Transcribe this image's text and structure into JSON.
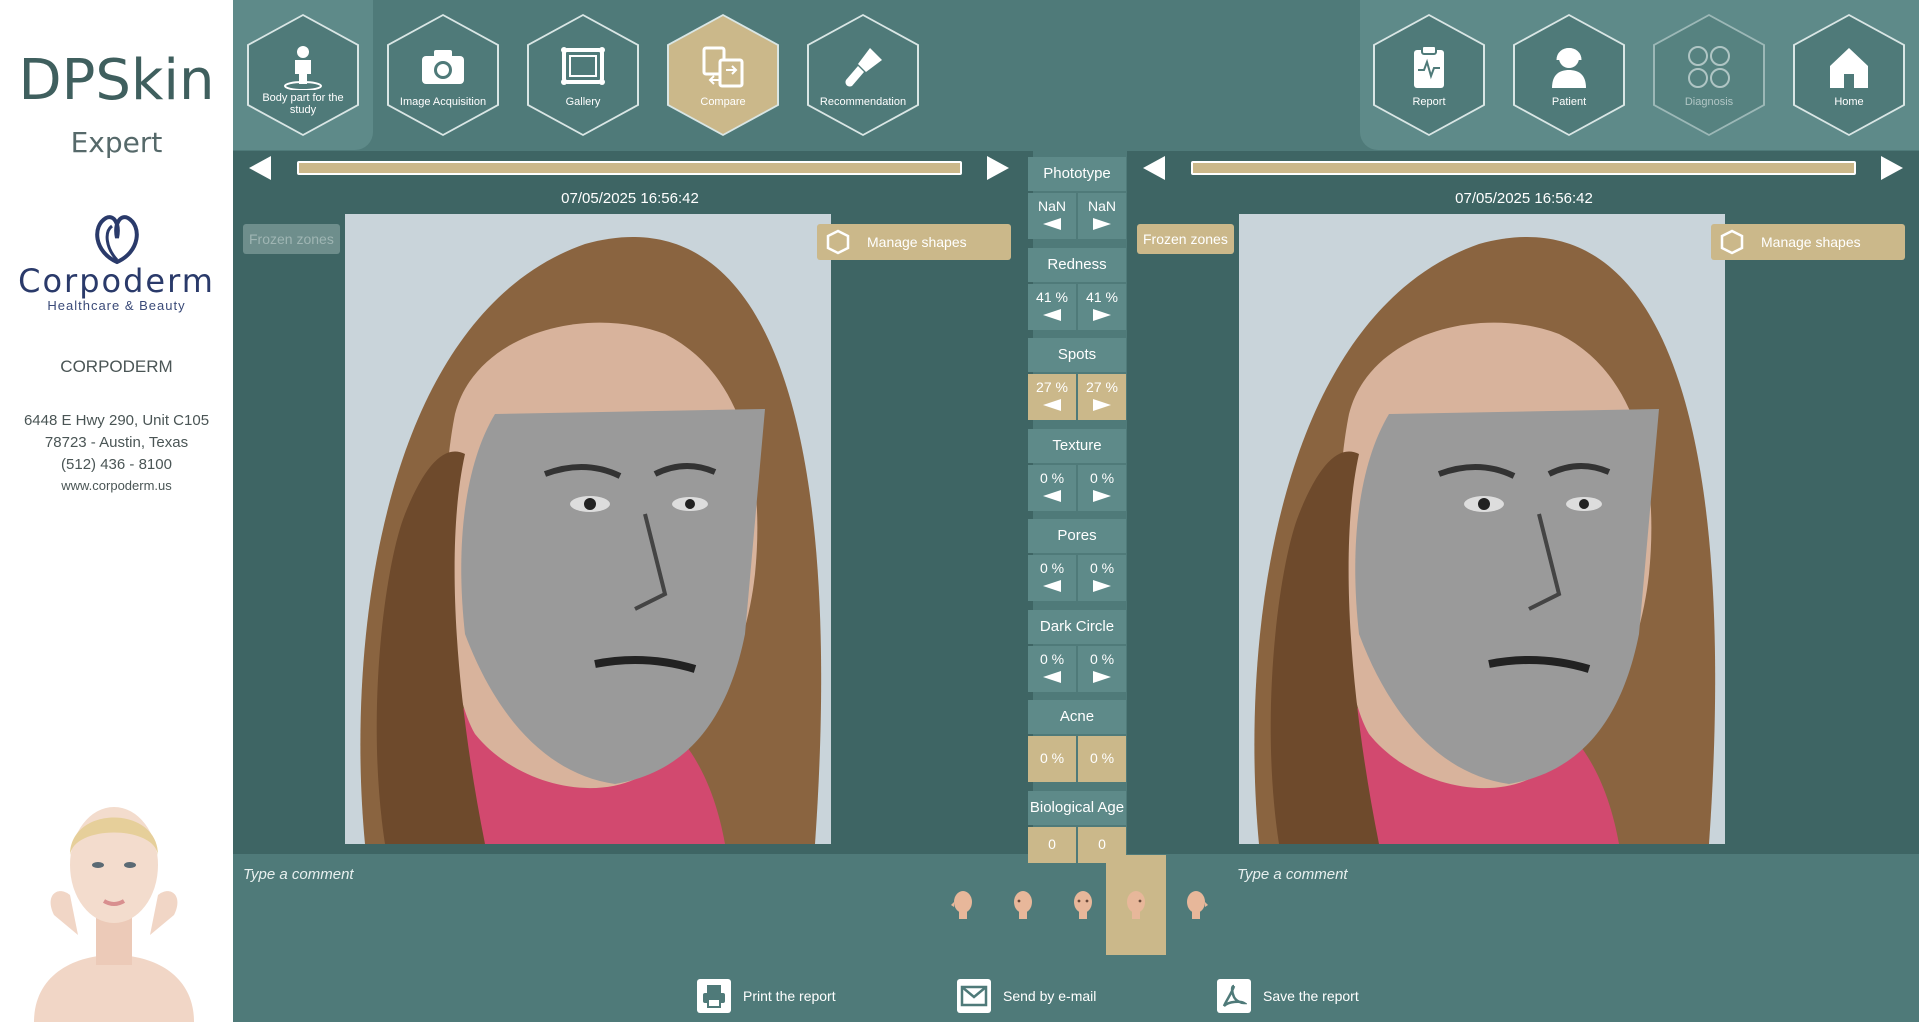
{
  "sidebar": {
    "app_title": "DPSkin",
    "app_subtitle": "Expert",
    "logo_name": "Corpoderm",
    "logo_tagline": "Healthcare & Beauty",
    "company": "CORPODERM",
    "address_line1": "6448 E Hwy 290, Unit C105",
    "address_line2": "78723  -  Austin, Texas",
    "phone": "(512) 436 - 8100",
    "website": "www.corpoderm.us"
  },
  "nav_left": [
    {
      "label": "Body part for the study",
      "icon": "body-part-icon"
    },
    {
      "label": "Image Acquisition",
      "icon": "camera-icon"
    },
    {
      "label": "Gallery",
      "icon": "gallery-icon"
    },
    {
      "label": "Compare",
      "icon": "compare-icon",
      "active": true
    },
    {
      "label": "Recommendation",
      "icon": "brush-icon"
    }
  ],
  "nav_right": [
    {
      "label": "Report",
      "icon": "clipboard-icon"
    },
    {
      "label": "Patient",
      "icon": "patient-icon"
    },
    {
      "label": "Diagnosis",
      "icon": "diagnosis-icon",
      "disabled": true
    },
    {
      "label": "Home",
      "icon": "home-icon"
    }
  ],
  "left_pane": {
    "date": "07/05/2025 16:56:42",
    "frozen_label": "Frozen zones",
    "manage_label": "Manage shapes",
    "comment_placeholder": "Type a comment"
  },
  "right_pane": {
    "date": "07/05/2025 16:56:42",
    "frozen_label": "Frozen zones",
    "manage_label": "Manage shapes",
    "comment_placeholder": "Type a comment"
  },
  "metrics": [
    {
      "name": "Phototype",
      "left": "NaN",
      "right": "NaN"
    },
    {
      "name": "Redness",
      "left": "41 %",
      "right": "41 %"
    },
    {
      "name": "Spots",
      "left": "27 %",
      "right": "27 %",
      "selected": true
    },
    {
      "name": "Texture",
      "left": "0 %",
      "right": "0 %"
    },
    {
      "name": "Pores",
      "left": "0 %",
      "right": "0 %"
    },
    {
      "name": "Dark Circle",
      "left": "0 %",
      "right": "0 %"
    },
    {
      "name": "Acne",
      "left": "0 %",
      "right": "0 %"
    },
    {
      "name": "Biological Age",
      "left": "0",
      "right": "0"
    }
  ],
  "actions": {
    "print": "Print the report",
    "email": "Send by e-mail",
    "save": "Save the report"
  },
  "colors": {
    "accent_gold": "#cbb88a",
    "panel": "#5e8a89",
    "background": "#4f7a79"
  }
}
